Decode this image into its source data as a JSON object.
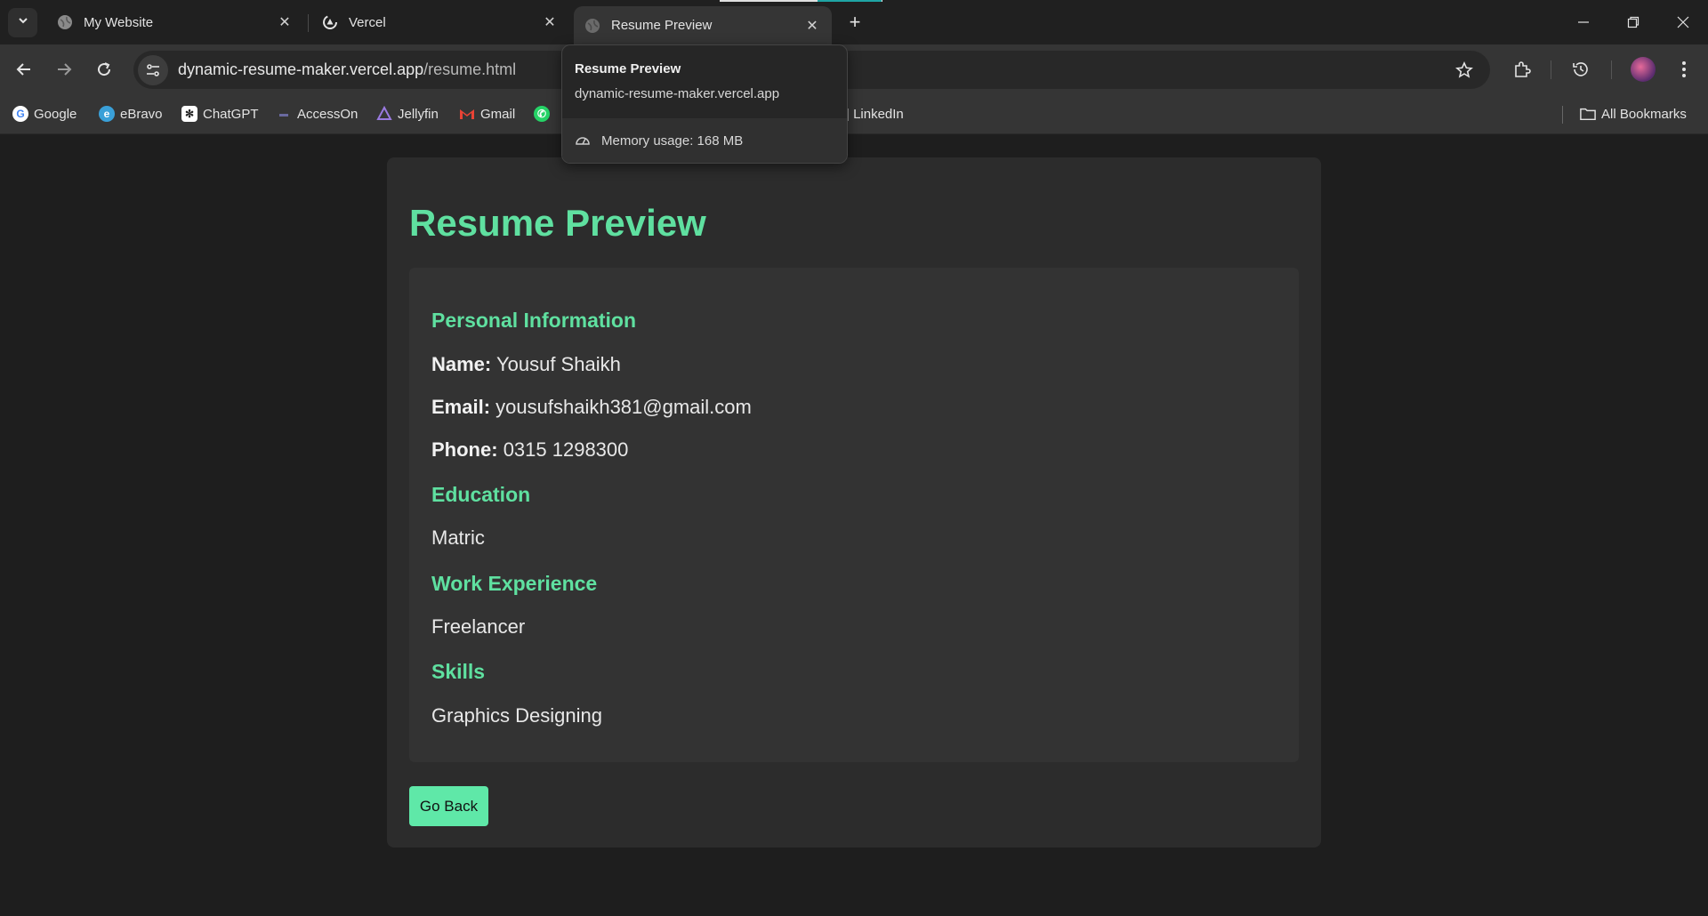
{
  "browser": {
    "tabs": [
      {
        "title": "My Website",
        "icon": "globe-icon"
      },
      {
        "title": "Vercel",
        "icon": "vercel-loading-icon"
      },
      {
        "title": "Resume Preview",
        "icon": "globe-icon",
        "active": true
      }
    ],
    "url_domain": "dynamic-resume-maker.vercel.app",
    "url_path": "/resume.html",
    "bookmarks": [
      {
        "label": "Google",
        "icon": "google-icon"
      },
      {
        "label": "eBravo",
        "icon": "ebravo-icon"
      },
      {
        "label": "ChatGPT",
        "icon": "chatgpt-icon"
      },
      {
        "label": "AccessOn",
        "icon": "accesson-icon"
      },
      {
        "label": "Jellyfin",
        "icon": "jellyfin-icon"
      },
      {
        "label": "Gmail",
        "icon": "gmail-icon"
      },
      {
        "label": "| LinkedIn",
        "icon": ""
      }
    ],
    "all_bookmarks": "All Bookmarks"
  },
  "tooltip": {
    "title": "Resume Preview",
    "domain": "dynamic-resume-maker.vercel.app",
    "memory": "Memory usage: 168 MB"
  },
  "resume": {
    "heading": "Resume Preview",
    "personal": {
      "title": "Personal Information",
      "name_label": "Name:",
      "name": "Yousuf Shaikh",
      "email_label": "Email:",
      "email": "yousufshaikh381@gmail.com",
      "phone_label": "Phone:",
      "phone": "0315 1298300"
    },
    "education": {
      "title": "Education",
      "value": "Matric"
    },
    "work": {
      "title": "Work Experience",
      "value": "Freelancer"
    },
    "skills": {
      "title": "Skills",
      "value": "Graphics Designing"
    },
    "go_back": "Go Back"
  },
  "colors": {
    "accent": "#5fe0a0",
    "button": "#5fe8a8",
    "background": "#1e1e1e",
    "card": "#2c2c2c"
  }
}
